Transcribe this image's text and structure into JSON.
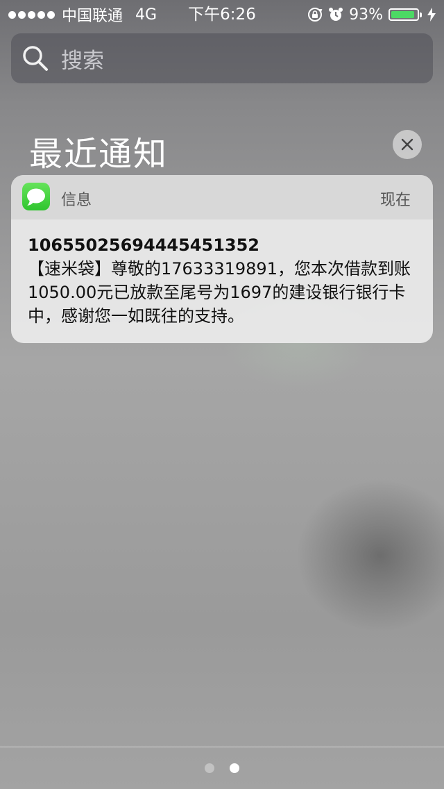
{
  "status_bar": {
    "carrier": "中国联通",
    "network": "4G",
    "time": "下午6:26",
    "battery_percent": "93%",
    "battery_level": 0.93,
    "battery_color": "#4cd964",
    "icons": [
      "rotation-lock-icon",
      "alarm-icon",
      "charging-bolt-icon"
    ]
  },
  "search": {
    "placeholder": "搜索"
  },
  "notifications": {
    "title": "最近通知",
    "clear_icon": "close-icon",
    "items": [
      {
        "app_name": "信息",
        "app_icon": "messages-icon",
        "time": "现在",
        "sender": "10655025694445451352",
        "body": "【速米袋】尊敬的17633319891，您本次借款到账1050.00元已放款至尾号为1697的建设银行银行卡中，感谢您一如既往的支持。"
      }
    ]
  },
  "pager": {
    "pages": 2,
    "current": 2
  }
}
